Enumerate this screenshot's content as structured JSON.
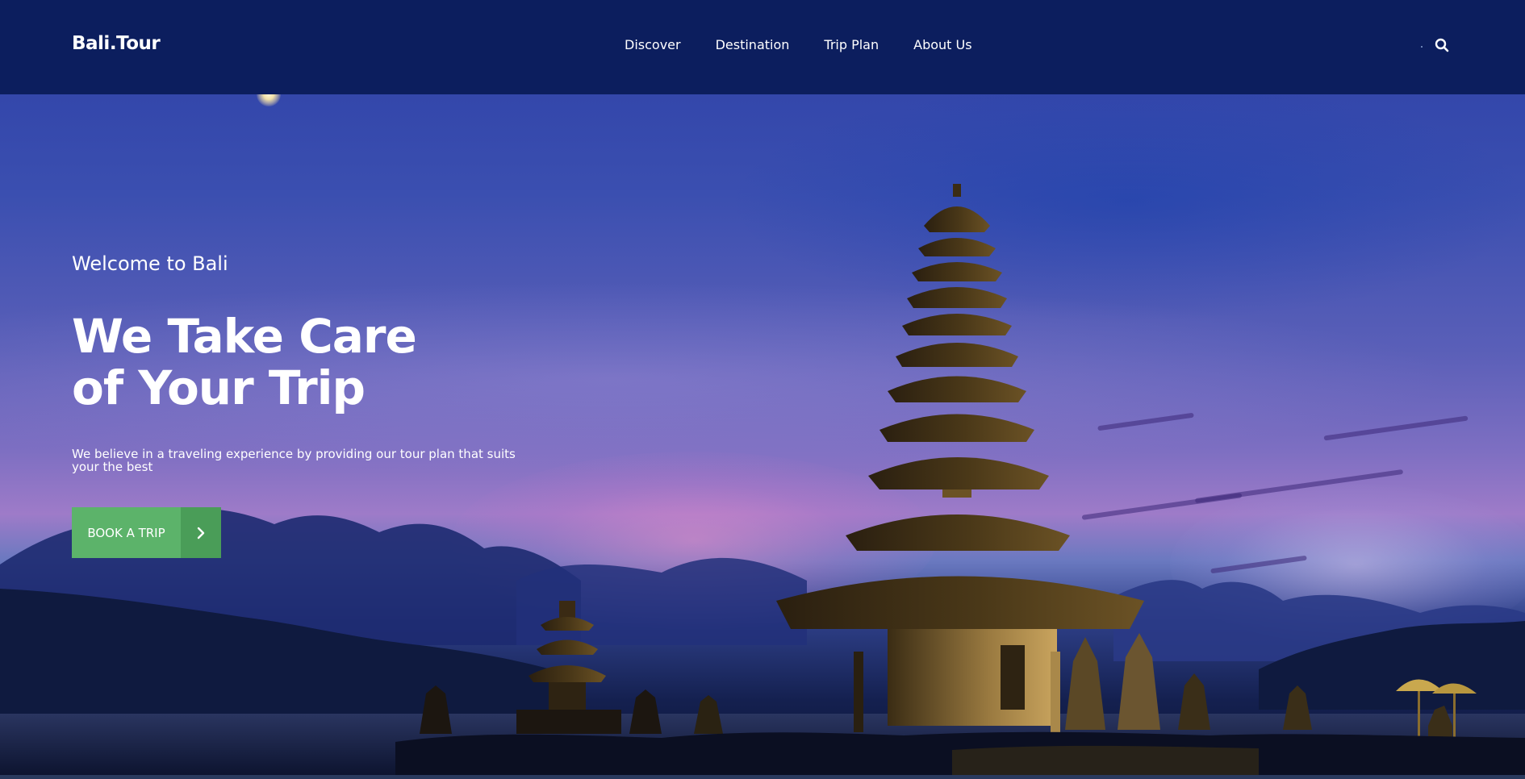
{
  "brand": {
    "logo": "Bali.Tour"
  },
  "nav": {
    "items": [
      {
        "label": "Discover"
      },
      {
        "label": "Destination"
      },
      {
        "label": "Trip Plan"
      },
      {
        "label": "About Us"
      }
    ]
  },
  "hero": {
    "welcome": "Welcome to Bali",
    "headline_line1": "We Take Care",
    "headline_line2": "of Your Trip",
    "subtext": "We believe in a traveling experience by providing our tour plan that suits your the best",
    "cta_label": "BOOK A TRIP",
    "cta_icon": "chevron-right-icon"
  },
  "icons": {
    "search": "search-icon"
  },
  "colors": {
    "header_bg": "#0c1e5e",
    "cta_bg": "#5cb36a",
    "cta_arrow_bg": "#4a9d58",
    "text": "#ffffff"
  }
}
